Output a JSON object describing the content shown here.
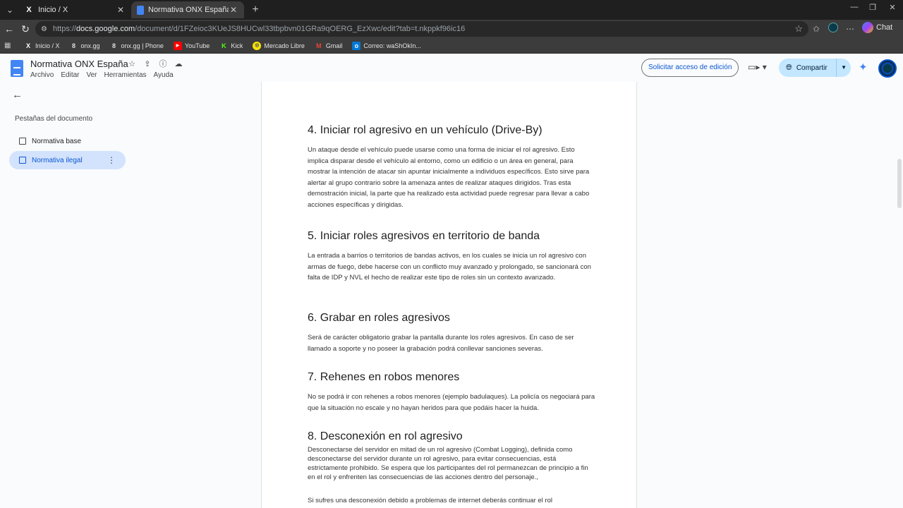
{
  "browser": {
    "tabs": [
      {
        "title": "Inicio / X",
        "icon": "x-logo-icon"
      },
      {
        "title": "Normativa ONX España - Documentos de Google",
        "icon": "google-docs-icon"
      }
    ],
    "url_prefix": "https://",
    "url_domain": "docs.google.com",
    "url_path": "/document/d/1FZeioc3KUeJS8HUCwl33tbpbvn01GRa9qOERG_EzXwc/edit?tab=t.nkppkf96ic16",
    "chat_label": "Chat",
    "bookmarks": [
      {
        "label": "Inicio / X",
        "icon": "x-logo-icon"
      },
      {
        "label": "onx.gg",
        "icon": "onx-icon"
      },
      {
        "label": "onx.gg | Phone",
        "icon": "onx-icon"
      },
      {
        "label": "YouTube",
        "icon": "youtube-icon"
      },
      {
        "label": "Kick",
        "icon": "kick-icon"
      },
      {
        "label": "Mercado Libre",
        "icon": "mercado-libre-icon"
      },
      {
        "label": "Gmail",
        "icon": "gmail-icon"
      },
      {
        "label": "Correo: waShOkIn...",
        "icon": "outlook-icon"
      }
    ]
  },
  "docs": {
    "title": "Normativa ONX España",
    "menu": [
      "Archivo",
      "Editar",
      "Ver",
      "Herramientas",
      "Ayuda"
    ],
    "request_edit": "Solicitar acceso de edición",
    "share": "Compartir"
  },
  "sidebar": {
    "heading": "Pestañas del documento",
    "tabs": [
      "Normativa base",
      "Normativa ilegal"
    ]
  },
  "document": {
    "sections": [
      {
        "heading": "4. Iniciar rol agresivo en un vehículo (Drive-By)",
        "body": "Un ataque desde el vehículo puede usarse como una forma de iniciar el rol agresivo. Esto implica disparar desde el vehículo al entorno, como un edificio o un área en general, para mostrar la intención de atacar sin apuntar inicialmente a individuos específicos. Esto sirve para alertar al grupo contrario sobre la amenaza antes de realizar ataques dirigidos. Tras esta demostración inicial, la parte que ha realizado esta actividad puede regresar para llevar a cabo acciones específicas y dirigidas."
      },
      {
        "heading": "5. Iniciar roles agresivos en territorio de banda",
        "body": "La entrada a barrios o territorios de bandas activos, en los cuales se inicia un rol agresivo con armas de fuego, debe hacerse con un conflicto muy avanzado y prolongado, se sancionará con falta de IDP y NVL el hecho de realizar este tipo de roles sin un contexto avanzado."
      },
      {
        "heading": "6. Grabar en roles agresivos",
        "body": "Será de carácter obligatorio grabar la pantalla durante los roles agresivos. En caso de ser llamado a soporte y no poseer la grabación podrá conllevar sanciones severas."
      },
      {
        "heading": "7. Rehenes en robos menores",
        "body": "No se podrá ir con rehenes a robos menores (ejemplo badulaques). La policía os negociará para que la situación no escale y no hayan heridos para que podáis hacer la huida."
      },
      {
        "heading": "8. Desconexión en rol agresivo",
        "body": "Desconectarse del servidor en mitad de un rol agresivo (Combat Logging), definida como desconectarse del servidor durante un rol agresivo, para evitar consecuencias, está estrictamente prohibido. Se espera que los participantes del rol permanezcan de principio a fin en el rol y enfrenten las consecuencias de las acciones dentro del personaje.,"
      },
      {
        "heading": "",
        "body": "Si sufres una desconexión debido a problemas de internet deberás continuar el rol"
      }
    ]
  }
}
